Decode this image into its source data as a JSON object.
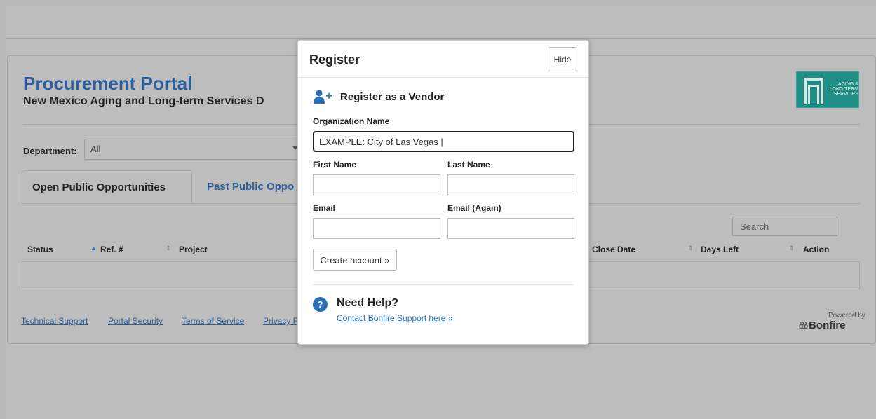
{
  "portal": {
    "title": "Procurement Portal",
    "subtitle": "New Mexico Aging and Long-term Services D",
    "logo_text": "AGING & LONG TERM SERVICES"
  },
  "filters": {
    "department_label": "Department:",
    "department_value": "All"
  },
  "tabs": [
    {
      "label": "Open Public Opportunities",
      "active": true
    },
    {
      "label": "Past Public Oppo",
      "active": false
    }
  ],
  "table": {
    "search_placeholder": "Search",
    "columns": [
      "Status",
      "Ref. #",
      "Project",
      "Close Date",
      "Days Left",
      "Action"
    ]
  },
  "footer": {
    "links": [
      "Technical Support",
      "Portal Security",
      "Terms of Service",
      "Privacy F"
    ],
    "powered_by": "Powered by",
    "brand": "Bonfire"
  },
  "modal": {
    "title": "Register",
    "hide_label": "Hide",
    "heading": "Register as a Vendor",
    "org_label": "Organization Name",
    "org_value": "EXAMPLE: City of Las Vegas |",
    "first_name_label": "First Name",
    "last_name_label": "Last Name",
    "email_label": "Email",
    "email_again_label": "Email (Again)",
    "create_label": "Create account »",
    "help_title": "Need Help?",
    "help_link": "Contact Bonfire Support here »"
  },
  "colors": {
    "accent": "#2a6fb5",
    "overlay": "#bdbdbd",
    "logo_bg": "#1f8f86"
  }
}
